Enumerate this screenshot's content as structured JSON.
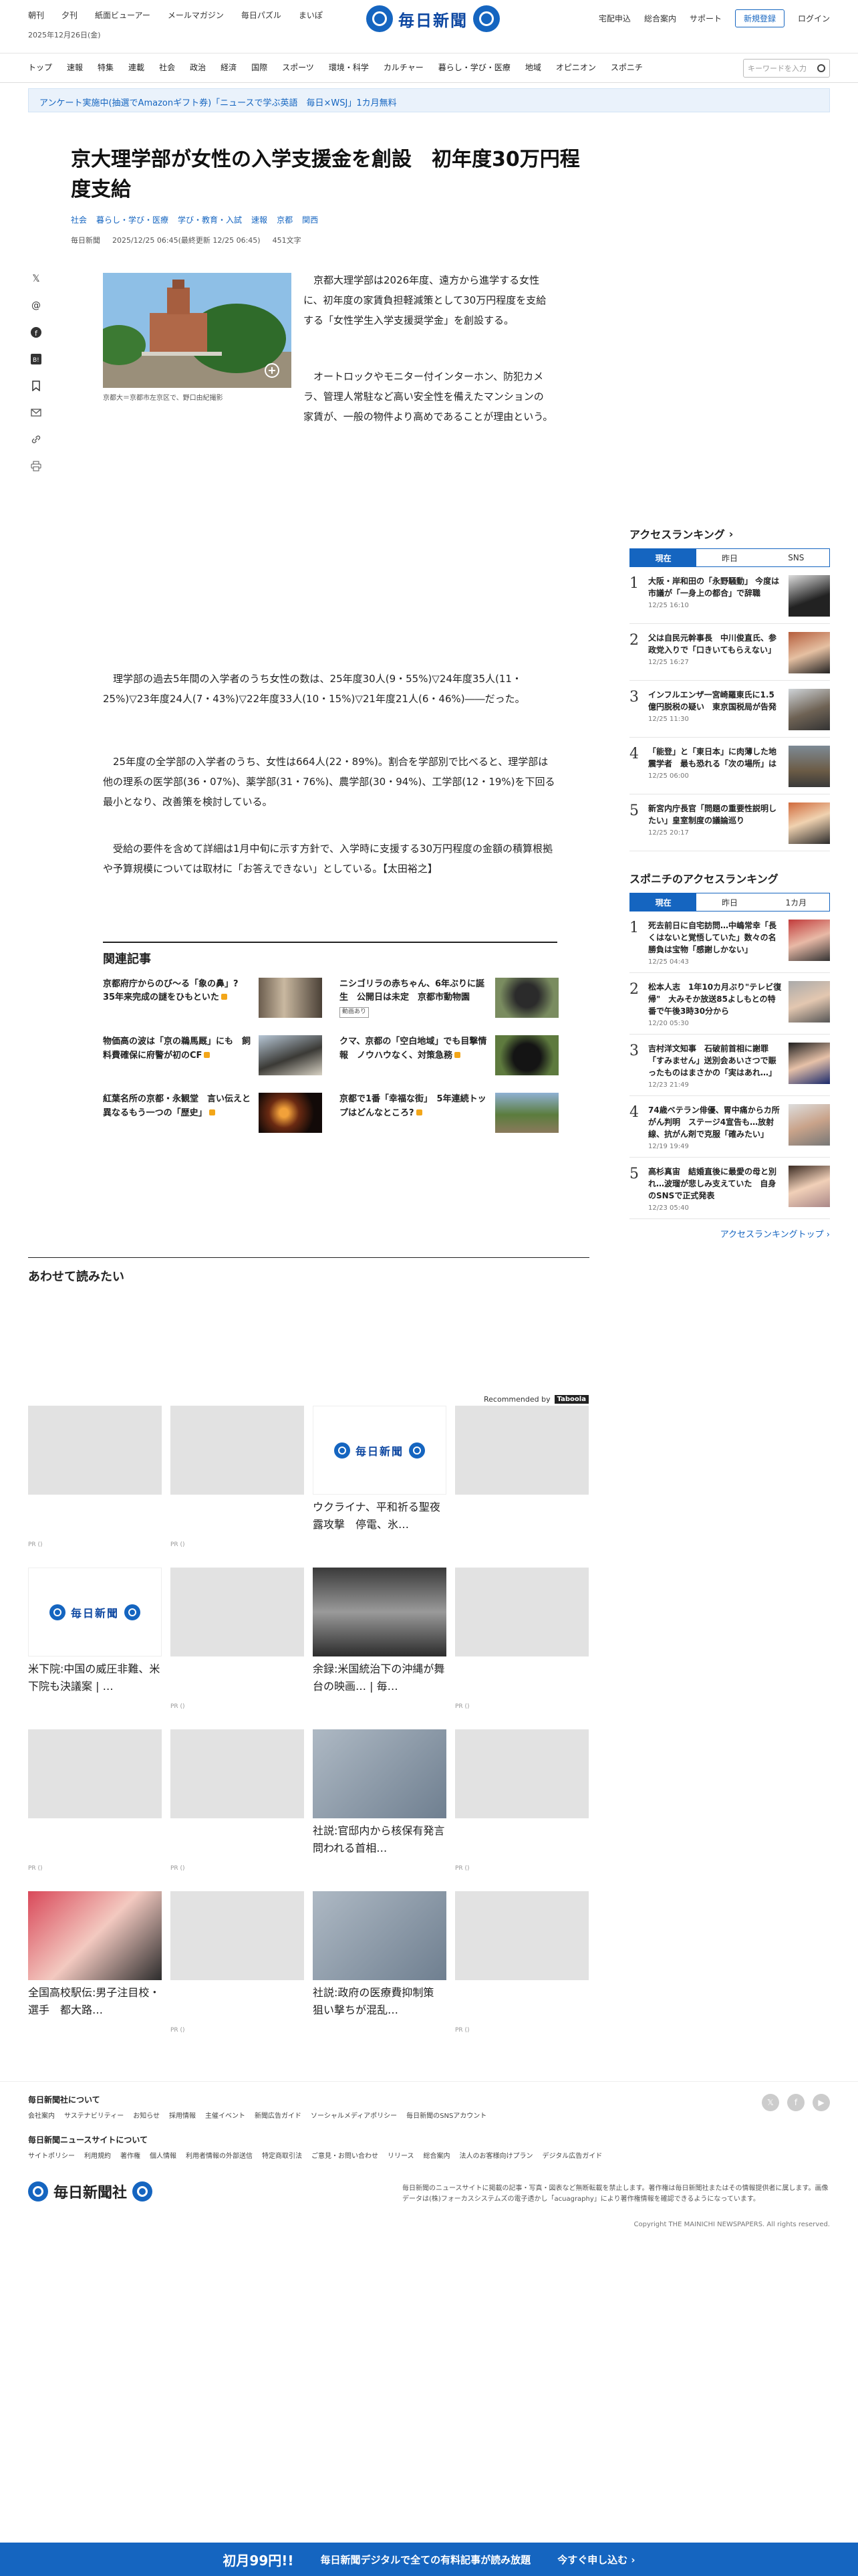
{
  "topbar": {
    "left_links": [
      "朝刊",
      "夕刊",
      "紙面ビューアー",
      "メールマガジン",
      "毎日パズル",
      "まいぽ"
    ],
    "date": "2025年12月26日(金)",
    "logo_text": "毎日新聞",
    "right_links": [
      "宅配申込",
      "総合案内",
      "サポート"
    ],
    "register_label": "新規登録",
    "login_label": "ログイン"
  },
  "nav": {
    "items": [
      "トップ",
      "速報",
      "特集",
      "連載",
      "社会",
      "政治",
      "経済",
      "国際",
      "スポーツ",
      "環境・科学",
      "カルチャー",
      "暮らし・学び・医療",
      "地域",
      "オピニオン",
      "スポニチ"
    ],
    "search_placeholder": "キーワードを入力"
  },
  "promo": {
    "text": "アンケート実施中(抽選でAmazonギフト券)「ニュースで学ぶ英語　毎日×WSJ」1カ月無料"
  },
  "article": {
    "title": "京大理学部が女性の入学支援金を創設　初年度30万円程度支給",
    "tags": [
      "社会",
      "暮らし・学び・医療",
      "学び・教育・入試",
      "速報",
      "京都",
      "関西"
    ],
    "source": "毎日新聞",
    "published": "2025/12/25 06:45(最終更新 12/25 06:45)",
    "chars": "451文字",
    "photo_caption": "京都大＝京都市左京区で、野口由紀撮影",
    "paragraphs": [
      "京都大理学部は2026年度、遠方から進学する女性に、初年度の家賃負担軽減策として30万円程度を支給する「女性学生入学支援奨学金」を創設する。",
      "オートロックやモニター付インターホン、防犯カメラ、管理人常駐など高い安全性を備えたマンションの家賃が、一般の物件より高めであることが理由という。",
      "理学部の過去5年間の入学者のうち女性の数は、25年度30人(9・55%)▽24年度35人(11・25%)▽23年度24人(7・43%)▽22年度33人(10・15%)▽21年度21人(6・46%)――だった。",
      "25年度の全学部の入学者のうち、女性は664人(22・89%)。割合を学部別で比べると、理学部は他の理系の医学部(36・07%)、薬学部(31・76%)、農学部(30・94%)、工学部(12・19%)を下回る最小となり、改善策を検討している。",
      "受給の要件を含めて詳細は1月中旬に示す方針で、入学時に支援する30万円程度の金額の積算根拠や予算規模については取材に「お答えできない」としている。【太田裕之】"
    ]
  },
  "share": {
    "icons": [
      "x-icon",
      "threads-icon",
      "facebook-icon",
      "hatena-icon",
      "bookmark-icon",
      "mail-icon",
      "link-icon",
      "print-icon"
    ]
  },
  "related": {
    "heading": "関連記事",
    "items": [
      {
        "title": "京都府庁からのび～る「象の鼻」?　35年来完成の謎をひもといた",
        "lock": true,
        "badge": ""
      },
      {
        "title": "ニシゴリラの赤ちゃん、6年ぶりに誕生　公開日は未定　京都市動物園",
        "lock": false,
        "badge": "動画あり"
      },
      {
        "title": "物価高の波は「京の鵜馬厩」にも　飼料費確保に府警が初のCF",
        "lock": true,
        "badge": ""
      },
      {
        "title": "クマ、京都の「空白地域」でも目撃情報　ノウハウなく、対策急務",
        "lock": true,
        "badge": ""
      },
      {
        "title": "紅葉名所の京都・永観堂　言い伝えと異なるもう一つの「歴史」",
        "lock": true,
        "badge": ""
      },
      {
        "title": "京都で1番「幸福な街」　5年連続トップはどんなところ?",
        "lock": true,
        "badge": ""
      }
    ]
  },
  "readalso": {
    "heading": "あわせて読みたい",
    "recommended": "Recommended by",
    "taboola": "Taboola",
    "cards": [
      {
        "title": "",
        "pr": "PR ()",
        "logo": false
      },
      {
        "title": "",
        "pr": "PR ()",
        "logo": false
      },
      {
        "title": "ウクライナ、平和祈る聖夜　露攻撃　停電、氷…",
        "pr": "",
        "logo": true
      },
      {
        "title": "",
        "pr": "",
        "logo": false
      },
      {
        "title": "米下院:中国の威圧非難、米下院も決議案 | …",
        "pr": "",
        "logo": true
      },
      {
        "title": "",
        "pr": "PR ()",
        "logo": false
      },
      {
        "title": "余録:米国統治下の沖縄が舞台の映画… | 毎…",
        "pr": "",
        "logo": false
      },
      {
        "title": "",
        "pr": "PR ()",
        "logo": false
      },
      {
        "title": "",
        "pr": "PR ()",
        "logo": false
      },
      {
        "title": "",
        "pr": "PR ()",
        "logo": false
      },
      {
        "title": "社説:官邸内から核保有発言　問われる首相…",
        "pr": "",
        "logo": false
      },
      {
        "title": "",
        "pr": "PR ()",
        "logo": false
      },
      {
        "title": "全国高校駅伝:男子注目校・選手　都大路…",
        "pr": "",
        "logo": false
      },
      {
        "title": "",
        "pr": "PR ()",
        "logo": false
      },
      {
        "title": "社説:政府の医療費抑制策　狙い撃ちが混乱…",
        "pr": "",
        "logo": false
      },
      {
        "title": "",
        "pr": "PR ()",
        "logo": false
      }
    ]
  },
  "ranking": {
    "heading": "アクセスランキング",
    "tabs": [
      "現在",
      "昨日",
      "SNS"
    ],
    "items": [
      {
        "n": "1",
        "title": "大阪・岸和田の「永野騒動」 今度は市議が「一身上の都合」で辞職",
        "date": "12/25 16:10"
      },
      {
        "n": "2",
        "title": "父は自民元幹事長　中川俊直氏、参政党入りで「口きいてもらえない」",
        "date": "12/25 16:27"
      },
      {
        "n": "3",
        "title": "インフルエンザ一宮崎羅東氏に1.5億円脱税の疑い　東京国税局が告発",
        "date": "12/25 11:30"
      },
      {
        "n": "4",
        "title": "「能登」と「東日本」に肉薄した地震学者　最も恐れる「次の場所」は",
        "date": "12/25 06:00"
      },
      {
        "n": "5",
        "title": "新宮内庁長官「問題の重要性説明したい」皇室制度の議論巡り",
        "date": "12/25 20:17"
      }
    ]
  },
  "sponichi": {
    "heading": "スポニチのアクセスランキング",
    "tabs": [
      "現在",
      "昨日",
      "1カ月"
    ],
    "items": [
      {
        "n": "1",
        "title": "死去前日に自宅訪問…中嶋常幸「長くはないと覚悟していた」数々の名勝負は宝物「感謝しかない」",
        "date": "12/25 04:43"
      },
      {
        "n": "2",
        "title": "松本人志　1年10カ月ぶり\"テレビ復帰\"　大みそか放送85よしもとの特番で午後3時30分から",
        "date": "12/20 05:30"
      },
      {
        "n": "3",
        "title": "吉村洋文知事　石破前首相に謝罪「すみません」送別会あいさつで賑ったものはまさかの「実はあれ…」",
        "date": "12/23 21:49"
      },
      {
        "n": "4",
        "title": "74歳ベテラン俳優、胃中痛からカ所がん判明　ステージ4宣告も…放射線、抗がん剤で克服「確みたい」",
        "date": "12/19 19:49"
      },
      {
        "n": "5",
        "title": "高杉真宙　結婚直後に最愛の母と別れ…波瑠が悲しみ支えていた　自身のSNSで正式発表",
        "date": "12/23 05:40"
      }
    ],
    "more": "アクセスランキングトップ"
  },
  "footer": {
    "about_heading": "毎日新聞社について",
    "about_links": [
      "会社案内",
      "サステナビリティー",
      "お知らせ",
      "採用情報",
      "主催イベント",
      "新聞広告ガイド",
      "ソーシャルメディアポリシー",
      "毎日新聞のSNSアカウント"
    ],
    "site_heading": "毎日新聞ニュースサイトについて",
    "site_links": [
      "サイトポリシー",
      "利用規約",
      "著作権",
      "個人情報",
      "利用者情報の外部送信",
      "特定商取引法",
      "ご意見・お問い合わせ",
      "リリース",
      "総合案内",
      "法人のお客様向けプラン",
      "デジタル広告ガイド"
    ],
    "logo_text": "毎日新聞社",
    "note": "毎日新聞のニュースサイトに掲載の記事・写真・図表など無断転載を禁止します。著作権は毎日新聞社またはその情報提供者に属します。画像データは(株)フォーカスシステムズの電子透かし「acuagraphy」により著作権情報を確認できるようになっています。",
    "copyright": "Copyright THE MAINICHI NEWSPAPERS. All rights reserved."
  },
  "banner": {
    "price": "初月99円!!",
    "text": "毎日新聞デジタルで全ての有料記事が読み放題",
    "cta": "今すぐ申し込む ›"
  },
  "colors": {
    "accent": "#1565c0",
    "lock": "#f3a619"
  }
}
